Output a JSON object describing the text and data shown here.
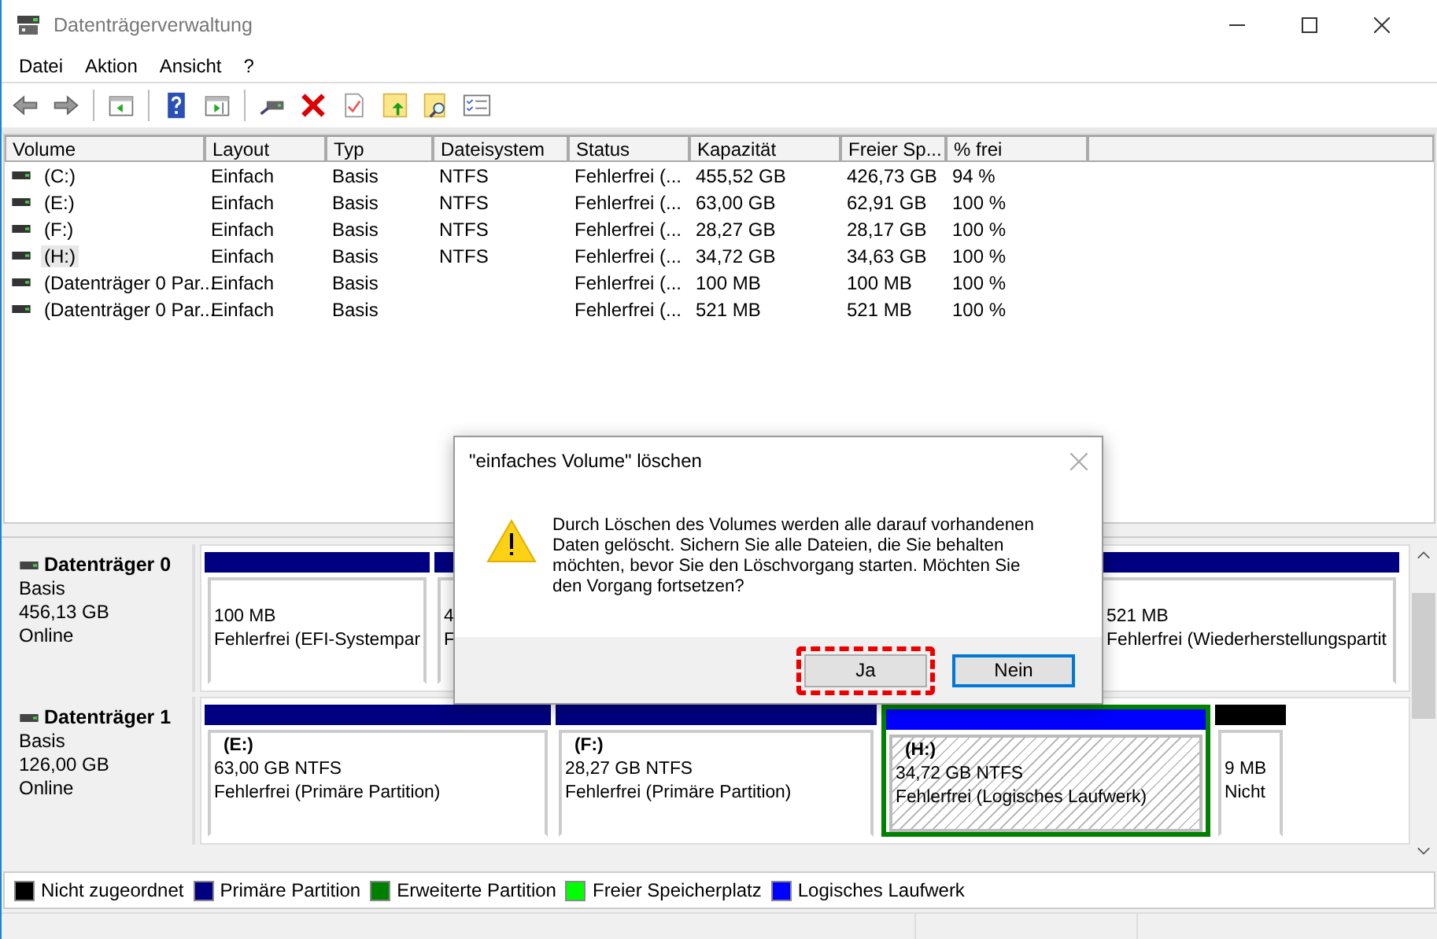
{
  "window": {
    "title": "Datenträgerverwaltung"
  },
  "menu": [
    "Datei",
    "Aktion",
    "Ansicht",
    "?"
  ],
  "table": {
    "columns": [
      "Volume",
      "Layout",
      "Typ",
      "Dateisystem",
      "Status",
      "Kapazität",
      "Freier Sp...",
      "% frei"
    ],
    "rows": [
      {
        "selected": false,
        "cells": [
          "(C:)",
          "Einfach",
          "Basis",
          "NTFS",
          "Fehlerfrei (...",
          "455,52 GB",
          "426,73 GB",
          "94 %"
        ]
      },
      {
        "selected": false,
        "cells": [
          "(E:)",
          "Einfach",
          "Basis",
          "NTFS",
          "Fehlerfrei (...",
          "63,00 GB",
          "62,91 GB",
          "100 %"
        ]
      },
      {
        "selected": false,
        "cells": [
          "(F:)",
          "Einfach",
          "Basis",
          "NTFS",
          "Fehlerfrei (...",
          "28,27 GB",
          "28,17 GB",
          "100 %"
        ]
      },
      {
        "selected": true,
        "cells": [
          "(H:)",
          "Einfach",
          "Basis",
          "NTFS",
          "Fehlerfrei (...",
          "34,72 GB",
          "34,63 GB",
          "100 %"
        ]
      },
      {
        "selected": false,
        "cells": [
          "(Datenträger 0 Par...",
          "Einfach",
          "Basis",
          "",
          "Fehlerfrei (...",
          "100 MB",
          "100 MB",
          "100 %"
        ]
      },
      {
        "selected": false,
        "cells": [
          "(Datenträger 0 Par...",
          "Einfach",
          "Basis",
          "",
          "Fehlerfrei (...",
          "521 MB",
          "521 MB",
          "100 %"
        ]
      }
    ]
  },
  "disks": [
    {
      "name": "Datenträger 0",
      "type": "Basis",
      "size": "456,13 GB",
      "state": "Online",
      "partitions": [
        {
          "kind": "primary",
          "selected": false,
          "size": "100 MB",
          "status": "Fehlerfrei (EFI-Systempar"
        },
        {
          "kind": "primary",
          "selected": false,
          "size": "4",
          "status": "F"
        },
        {
          "kind": "primary",
          "selected": false,
          "size": "521 MB",
          "status": "Fehlerfrei (Wiederherstellungspartit"
        }
      ]
    },
    {
      "name": "Datenträger 1",
      "type": "Basis",
      "size": "126,00 GB",
      "state": "Online",
      "partitions": [
        {
          "kind": "primary",
          "selected": false,
          "label": "(E:)",
          "size": "63,00 GB NTFS",
          "status": "Fehlerfrei (Primäre Partition)"
        },
        {
          "kind": "primary",
          "selected": false,
          "label": "(F:)",
          "size": "28,27 GB NTFS",
          "status": "Fehlerfrei (Primäre Partition)"
        },
        {
          "kind": "logical",
          "selected": true,
          "label": "(H:)",
          "size": "34,72 GB NTFS",
          "status": "Fehlerfrei (Logisches Laufwerk)"
        },
        {
          "kind": "unallocated",
          "selected": false,
          "size": "9 MB",
          "status": "Nicht"
        }
      ]
    }
  ],
  "legend": [
    {
      "label": "Nicht zugeordnet",
      "color": "#000000"
    },
    {
      "label": "Primäre Partition",
      "color": "#000080"
    },
    {
      "label": "Erweiterte Partition",
      "color": "#008000"
    },
    {
      "label": "Freier Speicherplatz",
      "color": "#00ff00"
    },
    {
      "label": "Logisches Laufwerk",
      "color": "#0000ff"
    }
  ],
  "dialog": {
    "title": "\"einfaches Volume\" löschen",
    "message": "Durch Löschen des Volumes werden alle darauf vorhandenen Daten gelöscht. Sichern Sie alle Dateien, die Sie behalten möchten, bevor Sie den Löschvorgang starten. Möchten Sie den Vorgang fortsetzen?",
    "buttons": [
      {
        "label": "Ja",
        "highlighted": true,
        "focused": false
      },
      {
        "label": "Nein",
        "highlighted": false,
        "focused": true
      }
    ]
  }
}
